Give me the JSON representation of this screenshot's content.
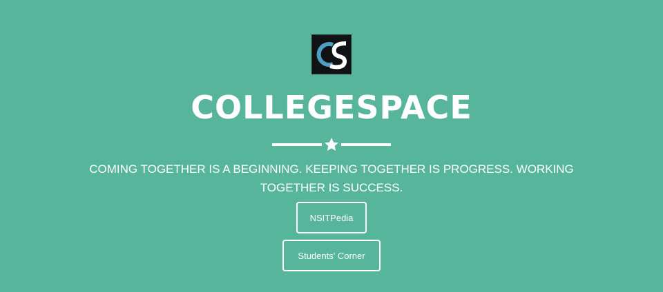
{
  "colors": {
    "background": "#56b59b",
    "foreground": "#ffffff",
    "logo_background": "#111214",
    "logo_c": "#4e9ec3",
    "logo_s": "#ffffff"
  },
  "logo": {
    "letters": "CS",
    "icon": "collegespace-logo-icon"
  },
  "hero": {
    "title": "COLLEGESPACE",
    "divider_icon": "star-icon",
    "tagline": "COMING TOGETHER IS A BEGINNING. KEEPING TOGETHER IS PROGRESS. WORKING TOGETHER IS SUCCESS."
  },
  "buttons": {
    "nsitpedia": "NSITPedia",
    "students_corner": "Students' Corner"
  }
}
